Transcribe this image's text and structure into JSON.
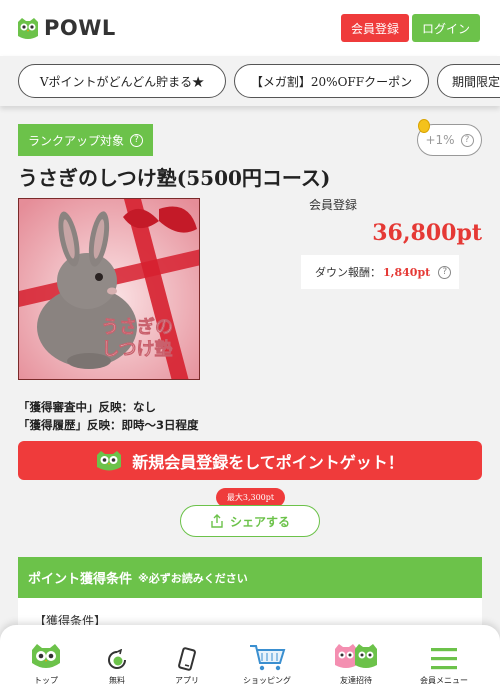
{
  "header": {
    "logo_text": "POWL",
    "register_label": "会員登録",
    "login_label": "ログイン"
  },
  "tabs": [
    {
      "label": "Vポイントがどんどん貯まる★"
    },
    {
      "label": "【メガ割】20%OFFクーポン"
    },
    {
      "label": "期間限定"
    }
  ],
  "offer": {
    "rank_badge": "ランクアップ対象",
    "rate_label": "+1%",
    "title": "うさぎのしつけ塾(5500円コース)",
    "image_text_line1": "うさぎの",
    "image_text_line2": "しつけ塾",
    "member_label": "会員登録",
    "points": "36,800pt",
    "down_label": "ダウン報酬：",
    "down_value": "1,840pt",
    "note_pending": "「獲得審査中」反映：なし",
    "note_history": "「獲得履歴」反映：即時～3日程度",
    "cta_label": "新規会員登録をしてポイントゲット！",
    "share_badge": "最大3,300pt",
    "share_label": "シェアする"
  },
  "conditions": {
    "title": "ポイント獲得条件",
    "subtitle": "※必ずお読みください",
    "label": "【獲得条件】"
  },
  "bottom_nav": [
    {
      "label": "トップ",
      "icon": "owl-icon"
    },
    {
      "label": "無料",
      "icon": "coin-circle-icon"
    },
    {
      "label": "アプリ",
      "icon": "phone-icon"
    },
    {
      "label": "ショッピング",
      "icon": "cart-icon"
    },
    {
      "label": "友達招待",
      "icon": "friends-owl-icon"
    },
    {
      "label": "会員メニュー",
      "icon": "menu-icon"
    }
  ],
  "colors": {
    "brand_green": "#6cc24a",
    "accent_red": "#ef3b3b"
  }
}
